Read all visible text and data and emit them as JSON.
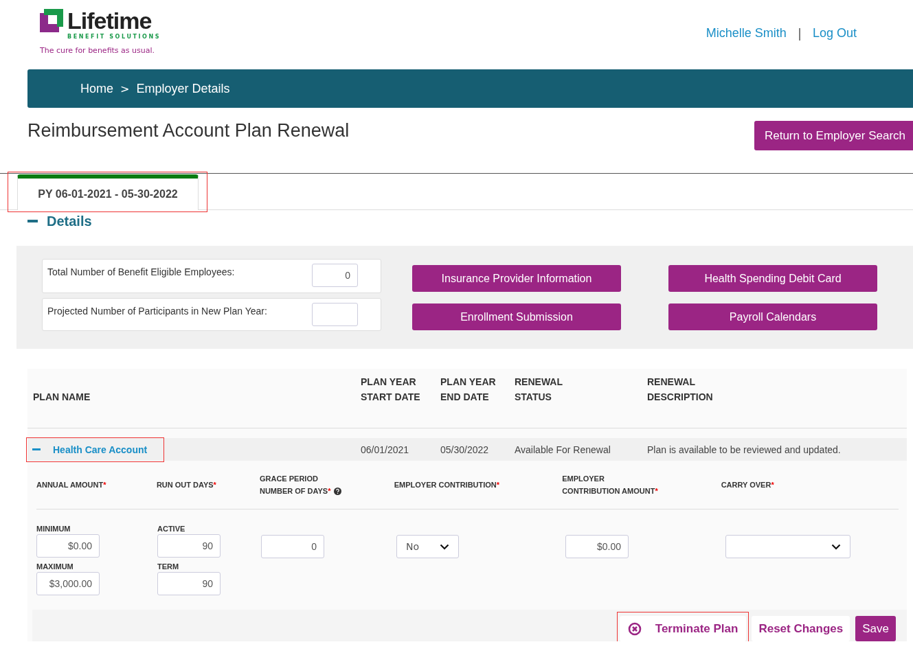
{
  "logo": {
    "name": "Lifetime",
    "subtitle": "BENEFIT SOLUTIONS",
    "tagline": "The cure for benefits as usual."
  },
  "user_links": [
    {
      "label": "Michelle Smith"
    },
    {
      "label": "Log Out"
    }
  ],
  "user_separator": "|",
  "breadcrumb": [
    "Home",
    "Employer Details"
  ],
  "breadcrumb_separator": ">",
  "page_title": "Reimbursement Account Plan Renewal",
  "return_button": "Return to Employer Search",
  "tabs": [
    {
      "label": "PY 06-01-2021 - 05-30-2022",
      "selected": true,
      "highlighted": true
    }
  ],
  "details": {
    "title": "Details",
    "expanded": true,
    "fields": [
      {
        "label": "Total Number of Benefit Eligible Employees:",
        "value": "0"
      },
      {
        "label": "Projected Number of Participants in New Plan Year:"
      }
    ],
    "buttons": [
      "Insurance Provider Information",
      "Health Spending Debit Card",
      "Enrollment Submission",
      "Payroll Calendars"
    ]
  },
  "plans_table": {
    "columns": [
      [
        "PLAN NAME"
      ],
      [
        "PLAN YEAR",
        "START DATE"
      ],
      [
        "PLAN YEAR",
        "END DATE"
      ],
      [
        "RENEWAL",
        "STATUS"
      ],
      [
        "RENEWAL",
        "DESCRIPTION"
      ]
    ],
    "rows": [
      {
        "name": "Health Care Account",
        "expanded": true,
        "highlighted": true,
        "start": "06/01/2021",
        "end": "05/30/2022",
        "status": "Available For Renewal",
        "description": "Plan is available to be reviewed and updated.",
        "form": {
          "headers": [
            {
              "lines": [
                "ANNUAL AMOUNT"
              ],
              "required": true,
              "help": false
            },
            {
              "lines": [
                "RUN OUT DAYS"
              ],
              "required": true,
              "help": false
            },
            {
              "lines": [
                "GRACE PERIOD",
                "NUMBER OF DAYS"
              ],
              "required": true,
              "help": true
            },
            {
              "lines": [
                "EMPLOYER CONTRIBUTION"
              ],
              "required": true,
              "help": false
            },
            {
              "lines": [
                "EMPLOYER",
                "CONTRIBUTION AMOUNT"
              ],
              "required": true,
              "help": false
            },
            {
              "lines": [
                "CARRY OVER"
              ],
              "required": true,
              "help": false
            }
          ],
          "required_mark": "*",
          "columns": [
            [
              {
                "kind": "input",
                "label": "MINIMUM",
                "value": "$0.00"
              },
              {
                "kind": "input",
                "label": "MAXIMUM",
                "value": "$3,000.00"
              }
            ],
            [
              {
                "kind": "input",
                "label": "ACTIVE",
                "value": "90"
              },
              {
                "kind": "input",
                "label": "TERM",
                "value": "90"
              }
            ],
            [
              {
                "kind": "input",
                "value": "0"
              }
            ],
            [
              {
                "kind": "select",
                "value": "No",
                "wide": false
              }
            ],
            [
              {
                "kind": "input",
                "value": "$0.00"
              }
            ],
            [
              {
                "kind": "select",
                "wide": true
              }
            ]
          ]
        }
      }
    ]
  },
  "actions": [
    {
      "label": "Terminate Plan",
      "kind": "terminate",
      "highlighted": true
    },
    {
      "label": "Reset Changes",
      "kind": "link",
      "highlighted": false
    },
    {
      "label": "Save",
      "kind": "primary",
      "highlighted": false
    }
  ]
}
